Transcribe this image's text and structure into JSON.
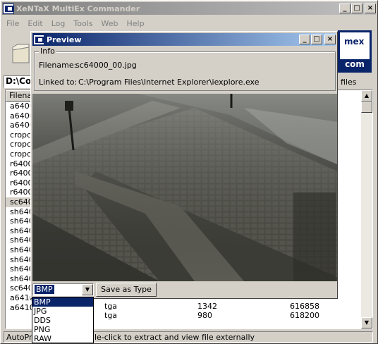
{
  "main_window": {
    "title": "XeNTaX MultiEx Commander",
    "menu": [
      "File",
      "Edit",
      "Log",
      "Tools",
      "Web",
      "Help"
    ],
    "path": "D:\\Co",
    "files_label": "files",
    "column_header": "Filena",
    "logo_line1": "mex",
    "logo_line2": "com",
    "file_rows": [
      "a6400",
      "a6400",
      "a6400",
      "cropcc",
      "cropcc",
      "cropcc",
      "r64000",
      "r64000",
      "r64000",
      "r64000",
      "sc640",
      "sh640",
      "sh640",
      "sh640",
      "sh640",
      "sh640",
      "sh640",
      "sh640",
      "sh640",
      "sc640",
      "a6410",
      "a6410"
    ],
    "selected_row_index": 10,
    "extra_rows": [
      {
        "type": "tga",
        "size": "1342",
        "offset": "616858"
      },
      {
        "type": "tga",
        "size": "980",
        "offset": "618200"
      }
    ],
    "status_left": "AutoPre",
    "status_right": "le-click to extract and view file externally"
  },
  "preview": {
    "title": "Preview",
    "info_legend": "Info",
    "filename_label": "Filename:",
    "filename_value": "sc64000_00.jpg",
    "linked_label": "Linked to:",
    "linked_value": "C:\\Program Files\\Internet Explorer\\iexplore.exe",
    "format_selected": "BMP",
    "format_options": [
      "BMP",
      "JPG",
      "DDS",
      "PNG",
      "RAW"
    ],
    "save_button": "Save as Type"
  },
  "colors": {
    "active_title": "#0a246a",
    "selection": "#0a246a",
    "face": "#d4d0c8"
  }
}
